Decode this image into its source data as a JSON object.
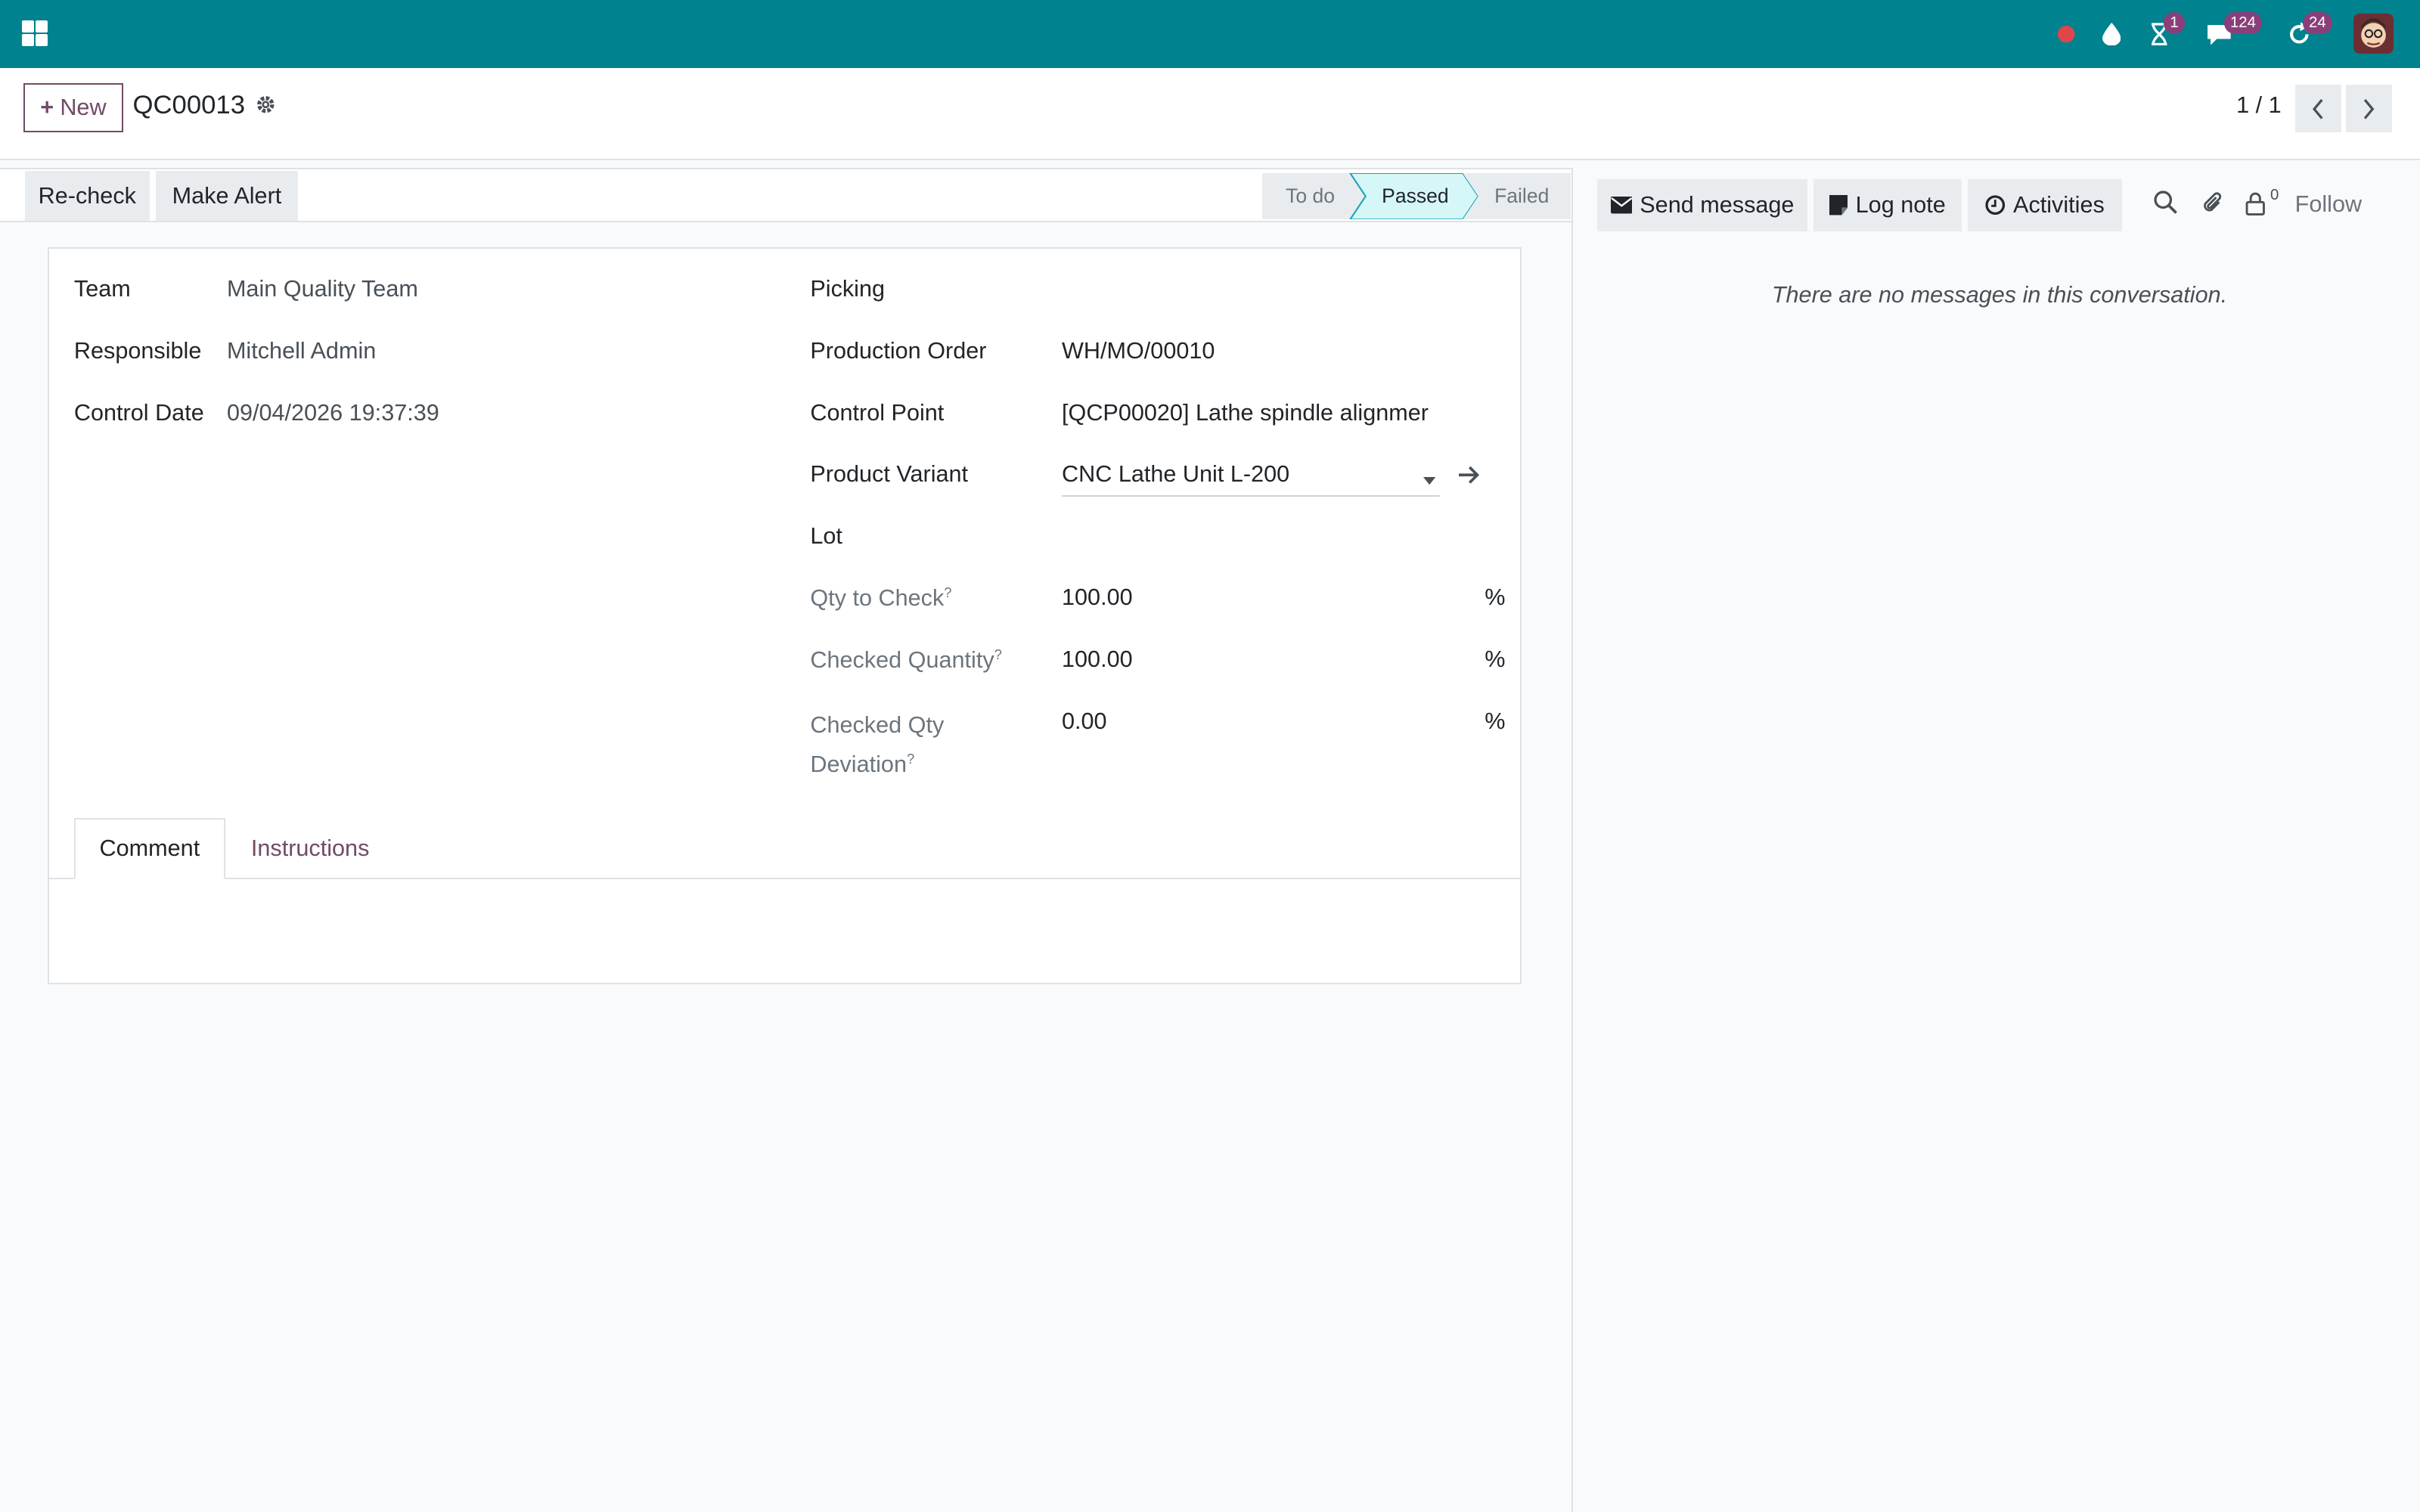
{
  "navbar": {
    "badges": {
      "activities": "1",
      "messages": "124",
      "updates": "24"
    },
    "colors": {
      "bar": "#00828f",
      "badge": "#8a3f7a"
    }
  },
  "control_panel": {
    "new_label": "New",
    "record_name": "QC00013",
    "pager": "1 / 1"
  },
  "statusbar": {
    "buttons": {
      "recheck": "Re-check",
      "make_alert": "Make Alert"
    },
    "stages": {
      "todo": "To do",
      "passed": "Passed",
      "failed": "Failed"
    },
    "active_stage": "Passed"
  },
  "form": {
    "team_label": "Team",
    "team": "Main Quality Team",
    "responsible_label": "Responsible",
    "responsible": "Mitchell Admin",
    "control_date_label": "Control Date",
    "control_date": "09/04/2026 19:37:39",
    "picking_label": "Picking",
    "production_order_label": "Production Order",
    "production_order": "WH/MO/00010",
    "control_point_label": "Control Point",
    "control_point": "[QCP00020] Lathe spindle alignmer",
    "product_variant_label": "Product Variant",
    "product_variant": "CNC Lathe Unit L-200",
    "lot_label": "Lot",
    "qty_to_check_label": "Qty to Check",
    "qty_to_check": "100.00",
    "checked_quantity_label": "Checked Quantity",
    "checked_quantity": "100.00",
    "checked_qty_deviation_label_1": "Checked Qty",
    "checked_qty_deviation_label_2": "Deviation",
    "checked_qty_deviation": "0.00",
    "unit": "%",
    "help_mark": "?",
    "tabs": {
      "comment": "Comment",
      "instructions": "Instructions"
    }
  },
  "chatter": {
    "send_message": "Send message",
    "log_note": "Log note",
    "activities": "Activities",
    "followers_count": "0",
    "follow": "Follow",
    "empty": "There are no messages in this conversation."
  }
}
